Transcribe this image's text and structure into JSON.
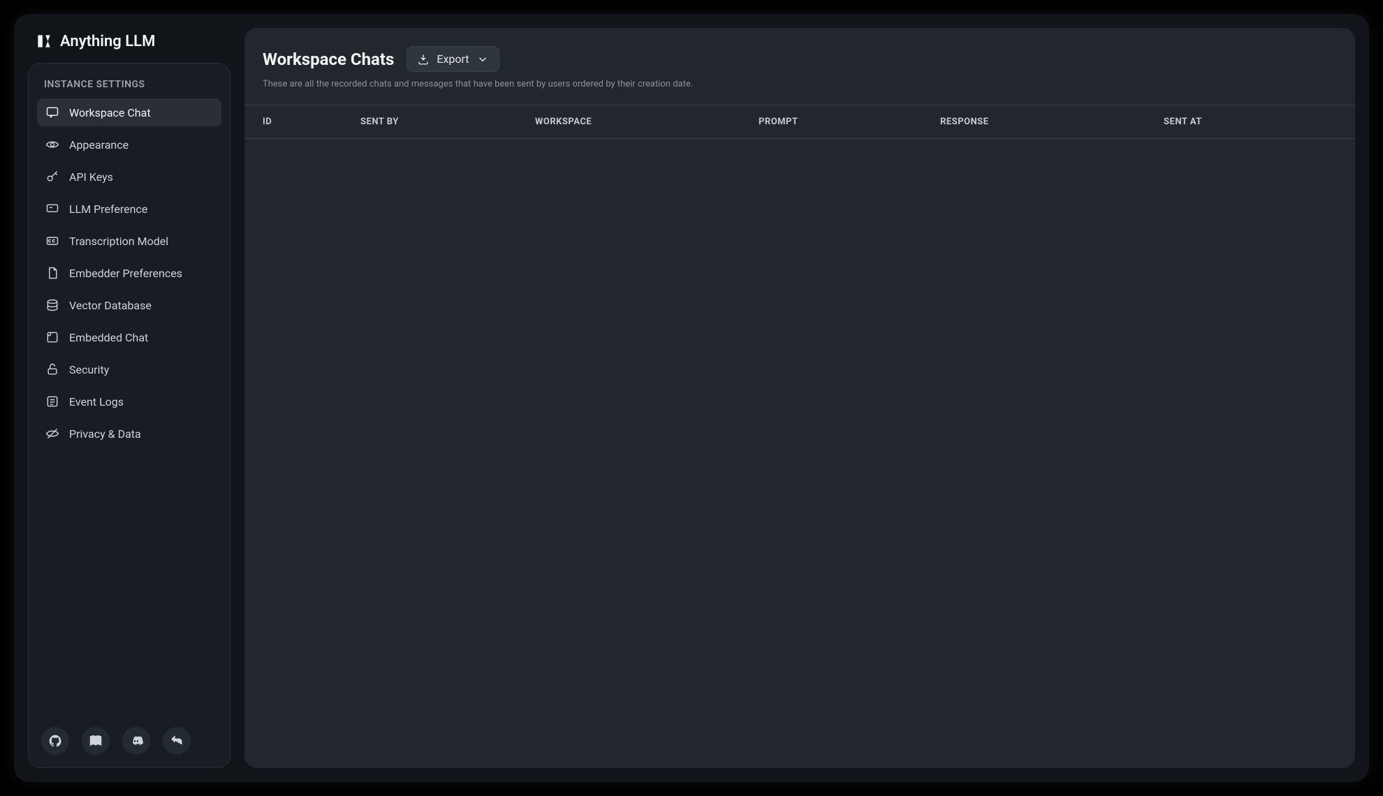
{
  "brand": {
    "name": "Anything LLM"
  },
  "sidebar": {
    "section_title": "INSTANCE SETTINGS",
    "items": [
      {
        "label": "Workspace Chat",
        "icon": "chat-icon",
        "active": true
      },
      {
        "label": "Appearance",
        "icon": "eye-icon",
        "active": false
      },
      {
        "label": "API Keys",
        "icon": "key-icon",
        "active": false
      },
      {
        "label": "LLM Preference",
        "icon": "message-icon",
        "active": false
      },
      {
        "label": "Transcription Model",
        "icon": "cc-icon",
        "active": false
      },
      {
        "label": "Embedder Preferences",
        "icon": "file-icon",
        "active": false
      },
      {
        "label": "Vector Database",
        "icon": "database-icon",
        "active": false
      },
      {
        "label": "Embedded Chat",
        "icon": "embed-icon",
        "active": false
      },
      {
        "label": "Security",
        "icon": "lock-icon",
        "active": false
      },
      {
        "label": "Event Logs",
        "icon": "list-icon",
        "active": false
      },
      {
        "label": "Privacy & Data",
        "icon": "eye-off-icon",
        "active": false
      }
    ],
    "footer_buttons": [
      "github",
      "docs",
      "discord",
      "back"
    ]
  },
  "main": {
    "title": "Workspace Chats",
    "export_label": "Export",
    "subtitle": "These are all the recorded chats and messages that have been sent by users ordered by their creation date.",
    "columns": [
      "ID",
      "SENT BY",
      "WORKSPACE",
      "PROMPT",
      "RESPONSE",
      "SENT AT"
    ],
    "rows": []
  }
}
